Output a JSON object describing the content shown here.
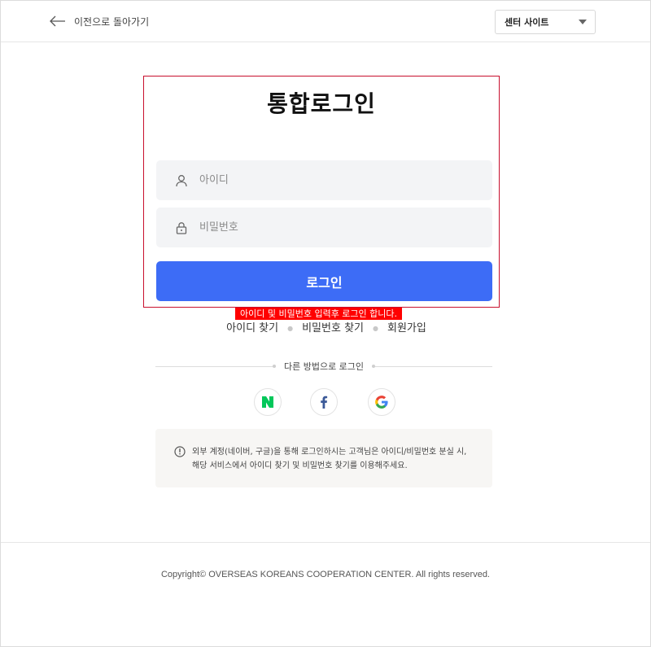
{
  "header": {
    "back_label": "이전으로 돌아가기",
    "site_select": "센터 사이트"
  },
  "login": {
    "title": "통합로그인",
    "id_placeholder": "아이디",
    "pw_placeholder": "비밀번호",
    "button_label": "로그인",
    "error_message": "아이디 및 비밀번호 입력후 로그인 합니다."
  },
  "links": {
    "find_id": "아이디 찾기",
    "find_pw": "비밀번호 찾기",
    "signup": "회원가입"
  },
  "other_login": {
    "label": "다른 방법으로 로그인",
    "providers": [
      {
        "name": "naver-icon",
        "color": "#03c75a"
      },
      {
        "name": "facebook-icon",
        "color": "#3b5998"
      },
      {
        "name": "google-icon",
        "color": "#4285f4"
      }
    ]
  },
  "notice": {
    "text": "외부 계정(네이버, 구글)을 통해 로그인하시는 고객님은 아이디/비밀번호 분실 시, 해당 서비스에서 아이디 찾기 및 비밀번호 찾기를 이용해주세요."
  },
  "footer": {
    "copyright": "Copyright© OVERSEAS KOREANS COOPERATION CENTER. All rights reserved."
  },
  "colors": {
    "primary": "#3d6cf6",
    "error_bg": "#ff0000",
    "box_border": "#c8102e"
  }
}
